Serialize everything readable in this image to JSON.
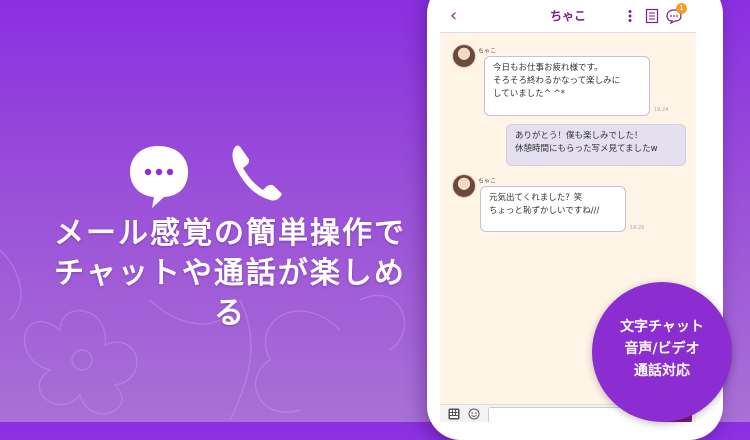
{
  "headline": {
    "line1": "メール感覚の簡単操作で",
    "line2": "チャットや通話が楽しめる"
  },
  "chat": {
    "title": "ちゃこ",
    "badge_count": "1",
    "messages": [
      {
        "sender": "ちゃこ",
        "lines": [
          "今日もお仕事お疲れ様です。",
          "そろそろ終わるかなって楽しみに",
          "していました^ ^*"
        ],
        "time": "19:24"
      },
      {
        "lines": [
          "ありがとう！僕も楽しみでした！",
          "休憩時間にもらった写メ見てましたw"
        ]
      },
      {
        "sender": "ちゃこ",
        "lines": [
          "元気出てくれました？笑",
          "ちょっと恥ずかしいですね///"
        ],
        "time": "19:26"
      }
    ]
  },
  "feature_badge": {
    "line1": "文字チャット",
    "line2": "音声/ビデオ",
    "line3": "通話対応"
  },
  "colors": {
    "accent": "#8a2fe0",
    "title": "#7b1f8e",
    "chat_bg": "#fff4e6"
  },
  "icons": [
    "chat-bubble-icon",
    "phone-icon",
    "back-chevron-icon",
    "more-icon",
    "memo-icon",
    "messages-icon",
    "keyboard-icon",
    "smile-icon",
    "call-icon"
  ]
}
